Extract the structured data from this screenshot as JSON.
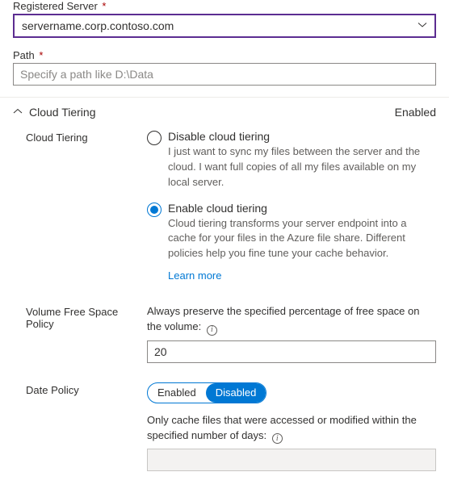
{
  "registeredServer": {
    "label": "Registered Server",
    "required": "*",
    "value": "servername.corp.contoso.com"
  },
  "path": {
    "label": "Path",
    "required": "*",
    "placeholder": "Specify a path like D:\\Data",
    "value": ""
  },
  "cloudTiering": {
    "sectionTitle": "Cloud Tiering",
    "status": "Enabled",
    "rowLabel": "Cloud Tiering",
    "disableOption": {
      "label": "Disable cloud tiering",
      "desc": "I just want to sync my files between the server and the cloud. I want full copies of all my files available on my local server."
    },
    "enableOption": {
      "label": "Enable cloud tiering",
      "desc": "Cloud tiering transforms your server endpoint into a cache for your files in the Azure file share. Different policies help you fine tune your cache behavior."
    },
    "learnMore": "Learn more"
  },
  "volumePolicy": {
    "label": "Volume Free Space Policy",
    "help": "Always preserve the specified percentage of free space on the volume:",
    "value": "20"
  },
  "datePolicy": {
    "label": "Date Policy",
    "toggle": {
      "enabled": "Enabled",
      "disabled": "Disabled"
    },
    "help": "Only cache files that were accessed or modified within the specified number of days:",
    "value": ""
  }
}
